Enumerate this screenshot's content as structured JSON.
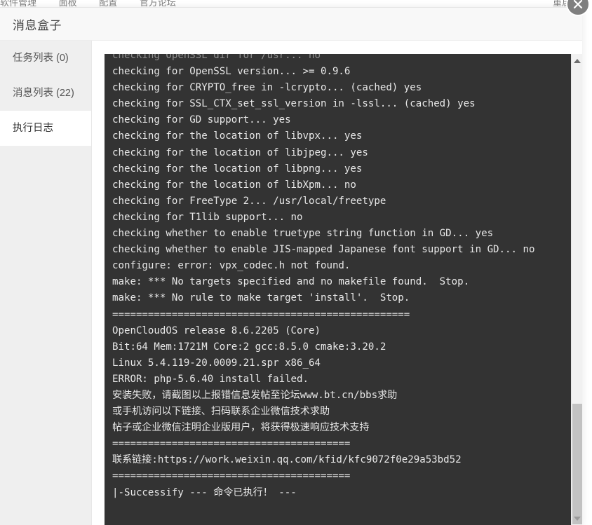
{
  "background_page": {
    "menu_items": [
      "软件管理",
      "面板",
      "配置",
      "官方论坛"
    ],
    "right_label": "重启"
  },
  "dialog": {
    "title": "消息盒子",
    "close_icon": "close-icon"
  },
  "sidebar": {
    "items": [
      {
        "label": "任务列表 (0)",
        "active": false
      },
      {
        "label": "消息列表 (22)",
        "active": false
      },
      {
        "label": "执行日志",
        "active": true
      }
    ]
  },
  "terminal": {
    "clipped_first_line": "checking OpenSSL dir for /usr... no",
    "lines": [
      "checking for OpenSSL version... >= 0.9.6",
      "checking for CRYPTO_free in -lcrypto... (cached) yes",
      "checking for SSL_CTX_set_ssl_version in -lssl... (cached) yes",
      "checking for GD support... yes",
      "checking for the location of libvpx... yes",
      "checking for the location of libjpeg... yes",
      "checking for the location of libpng... yes",
      "checking for the location of libXpm... no",
      "checking for FreeType 2... /usr/local/freetype",
      "checking for T1lib support... no",
      "checking whether to enable truetype string function in GD... yes",
      "checking whether to enable JIS-mapped Japanese font support in GD... no",
      "configure: error: vpx_codec.h not found.",
      "make: *** No targets specified and no makefile found.  Stop.",
      "make: *** No rule to make target 'install'.  Stop.",
      "==================================================",
      "OpenCloudOS release 8.6.2205 (Core)",
      "Bit:64 Mem:1721M Core:2 gcc:8.5.0 cmake:3.20.2",
      "Linux 5.4.119-20.0009.21.spr x86_64",
      "ERROR: php-5.6.40 install failed.",
      "安装失败，请截图以上报错信息发帖至论坛www.bt.cn/bbs求助",
      "或手机访问以下链接、扫码联系企业微信技术求助",
      "帖子或企业微信注明企业版用户，将获得极速响应技术支持",
      "========================================",
      "联系链接:https://work.weixin.qq.com/kfid/kfc9072f0e29a53bd52",
      "========================================",
      "|-Successify --- 命令已执行！ ---"
    ]
  },
  "scrollbar": {
    "up_icon": "triangle-up-icon",
    "down_icon": "triangle-down-icon",
    "thumb": "scroll-thumb"
  },
  "colors": {
    "terminal_bg": "#333333",
    "terminal_text": "#e8e8e8",
    "sidebar_bg": "#efefef",
    "header_bg": "#f8f8f8"
  }
}
